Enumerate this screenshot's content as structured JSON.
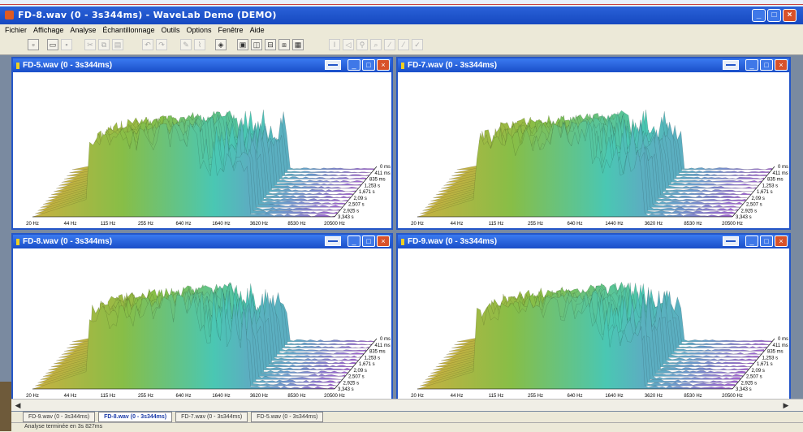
{
  "app": {
    "title": "FD-8.wav (0 - 3s344ms) - WaveLab Demo (DEMO)",
    "window_buttons": [
      "_",
      "□",
      "×"
    ]
  },
  "menu": [
    "Fichier",
    "Affichage",
    "Analyse",
    "Échantillonnage",
    "Outils",
    "Options",
    "Fenêtre",
    "Aide"
  ],
  "documents": [
    {
      "title": "FD-5.wav (0 - 3s344ms)",
      "freq_ticks": [
        "20 Hz",
        "44 Hz",
        "115 Hz",
        "255 Hz",
        "640 Hz",
        "1640 Hz",
        "3620 Hz",
        "8530 Hz",
        "20500 Hz"
      ],
      "time_ticks": [
        "0 ms",
        "411 ms",
        "835 ms",
        "1,253 s",
        "1,671 s",
        "2,09 s",
        "2,507 s",
        "2,925 s",
        "3,343 s"
      ]
    },
    {
      "title": "FD-7.wav (0 - 3s344ms)",
      "freq_ticks": [
        "20 Hz",
        "44 Hz",
        "115 Hz",
        "255 Hz",
        "640 Hz",
        "1440 Hz",
        "3620 Hz",
        "8530 Hz",
        "20500 Hz"
      ],
      "time_ticks": [
        "0 ms",
        "411 ms",
        "835 ms",
        "1,253 s",
        "1,671 s",
        "2,09 s",
        "2,507 s",
        "2,925 s",
        "3,343 s"
      ]
    },
    {
      "title": "FD-8.wav (0 - 3s344ms)",
      "freq_ticks": [
        "20 Hz",
        "44 Hz",
        "115 Hz",
        "255 Hz",
        "640 Hz",
        "1640 Hz",
        "3620 Hz",
        "8530 Hz",
        "20500 Hz"
      ],
      "time_ticks": [
        "0 ms",
        "411 ms",
        "835 ms",
        "1,253 s",
        "1,671 s",
        "2,09 s",
        "2,507 s",
        "2,925 s",
        "3,343 s"
      ]
    },
    {
      "title": "FD-9.wav (0 - 3s344ms)",
      "freq_ticks": [
        "20 Hz",
        "44 Hz",
        "115 Hz",
        "255 Hz",
        "640 Hz",
        "1640 Hz",
        "3620 Hz",
        "8530 Hz",
        "20500 Hz"
      ],
      "time_ticks": [
        "0 ms",
        "411 ms",
        "835 ms",
        "1,253 s",
        "1,671 s",
        "2,09 s",
        "2,507 s",
        "2,925 s",
        "3,343 s"
      ]
    }
  ],
  "tabs": [
    {
      "label": "FD-9.wav (0 - 3s344ms)",
      "active": false
    },
    {
      "label": "FD-8.wav (0 - 3s344ms)",
      "active": true
    },
    {
      "label": "FD-7.wav (0 - 3s344ms)",
      "active": false
    },
    {
      "label": "FD-5.wav (0 - 3s344ms)",
      "active": false
    }
  ],
  "status": "Analyse terminée en 3s 827ms",
  "colors": {
    "titlebar": "#1648c0",
    "close_button": "#d8522a",
    "plot_low": "#c8b040",
    "plot_mid": "#7cc048",
    "plot_high": "#40c8c8",
    "plot_far": "#a060d0"
  }
}
